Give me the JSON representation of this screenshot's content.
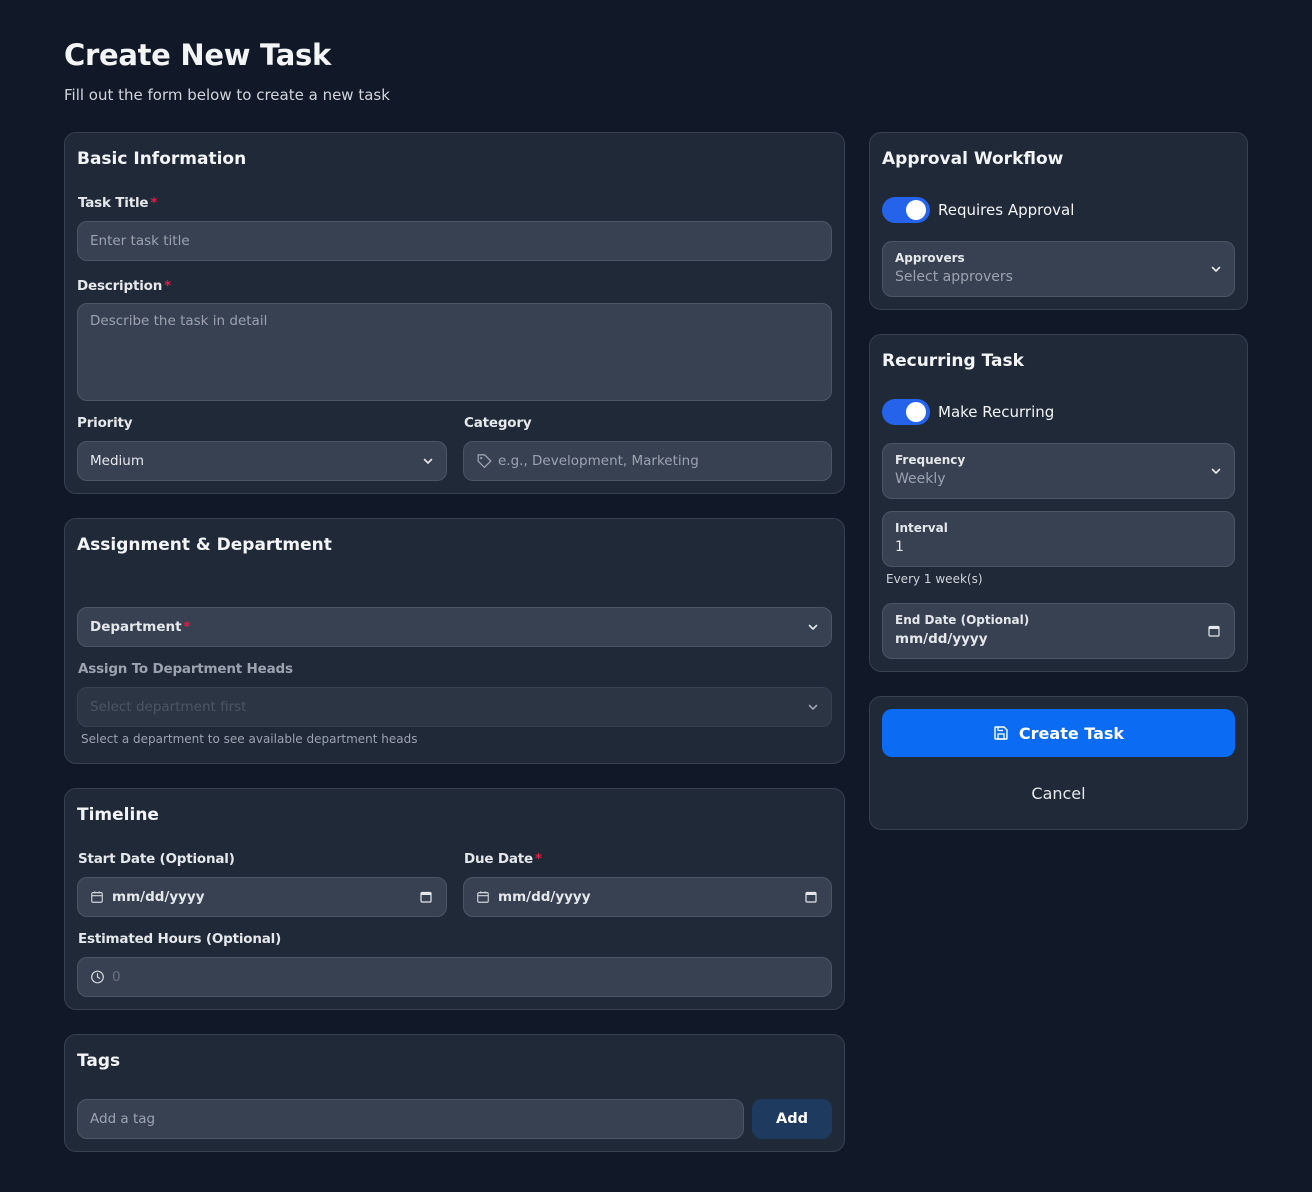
{
  "header": {
    "title": "Create New Task",
    "subtitle": "Fill out the form below to create a new task"
  },
  "basic_info": {
    "title": "Basic Information",
    "task_title_label": "Task Title",
    "task_title_placeholder": "Enter task title",
    "description_label": "Description",
    "description_placeholder": "Describe the task in detail",
    "priority_label": "Priority",
    "priority_value": "Medium",
    "category_label": "Category",
    "category_placeholder": "e.g., Development, Marketing",
    "required_mark": "*"
  },
  "assignment": {
    "title": "Assignment & Department",
    "department_label": "Department",
    "assign_label": "Assign To Department Heads",
    "assign_placeholder": "Select department first",
    "assign_hint": "Select a department to see available department heads",
    "required_mark": "*"
  },
  "timeline": {
    "title": "Timeline",
    "start_label": "Start Date (Optional)",
    "start_value": "mm/dd/yyyy",
    "due_label": "Due Date",
    "due_value": "mm/dd/yyyy",
    "hours_label": "Estimated Hours (Optional)",
    "hours_placeholder": "0",
    "required_mark": "*"
  },
  "tags": {
    "title": "Tags",
    "input_placeholder": "Add a tag",
    "add_label": "Add"
  },
  "approval": {
    "title": "Approval Workflow",
    "toggle_label": "Requires Approval",
    "toggle_on": true,
    "approvers_label": "Approvers",
    "approvers_placeholder": "Select approvers"
  },
  "recurring": {
    "title": "Recurring Task",
    "toggle_label": "Make Recurring",
    "toggle_on": true,
    "frequency_label": "Frequency",
    "frequency_value": "Weekly",
    "interval_label": "Interval",
    "interval_value": "1",
    "interval_hint": "Every 1 week(s)",
    "end_date_label": "End Date (Optional)",
    "end_date_value": "mm/dd/yyyy"
  },
  "actions": {
    "create_label": "Create Task",
    "cancel_label": "Cancel"
  },
  "colors": {
    "background": "#111827",
    "card": "#1f2937",
    "field": "#374151",
    "accent": "#0b6bf2",
    "required": "#e11d48"
  }
}
